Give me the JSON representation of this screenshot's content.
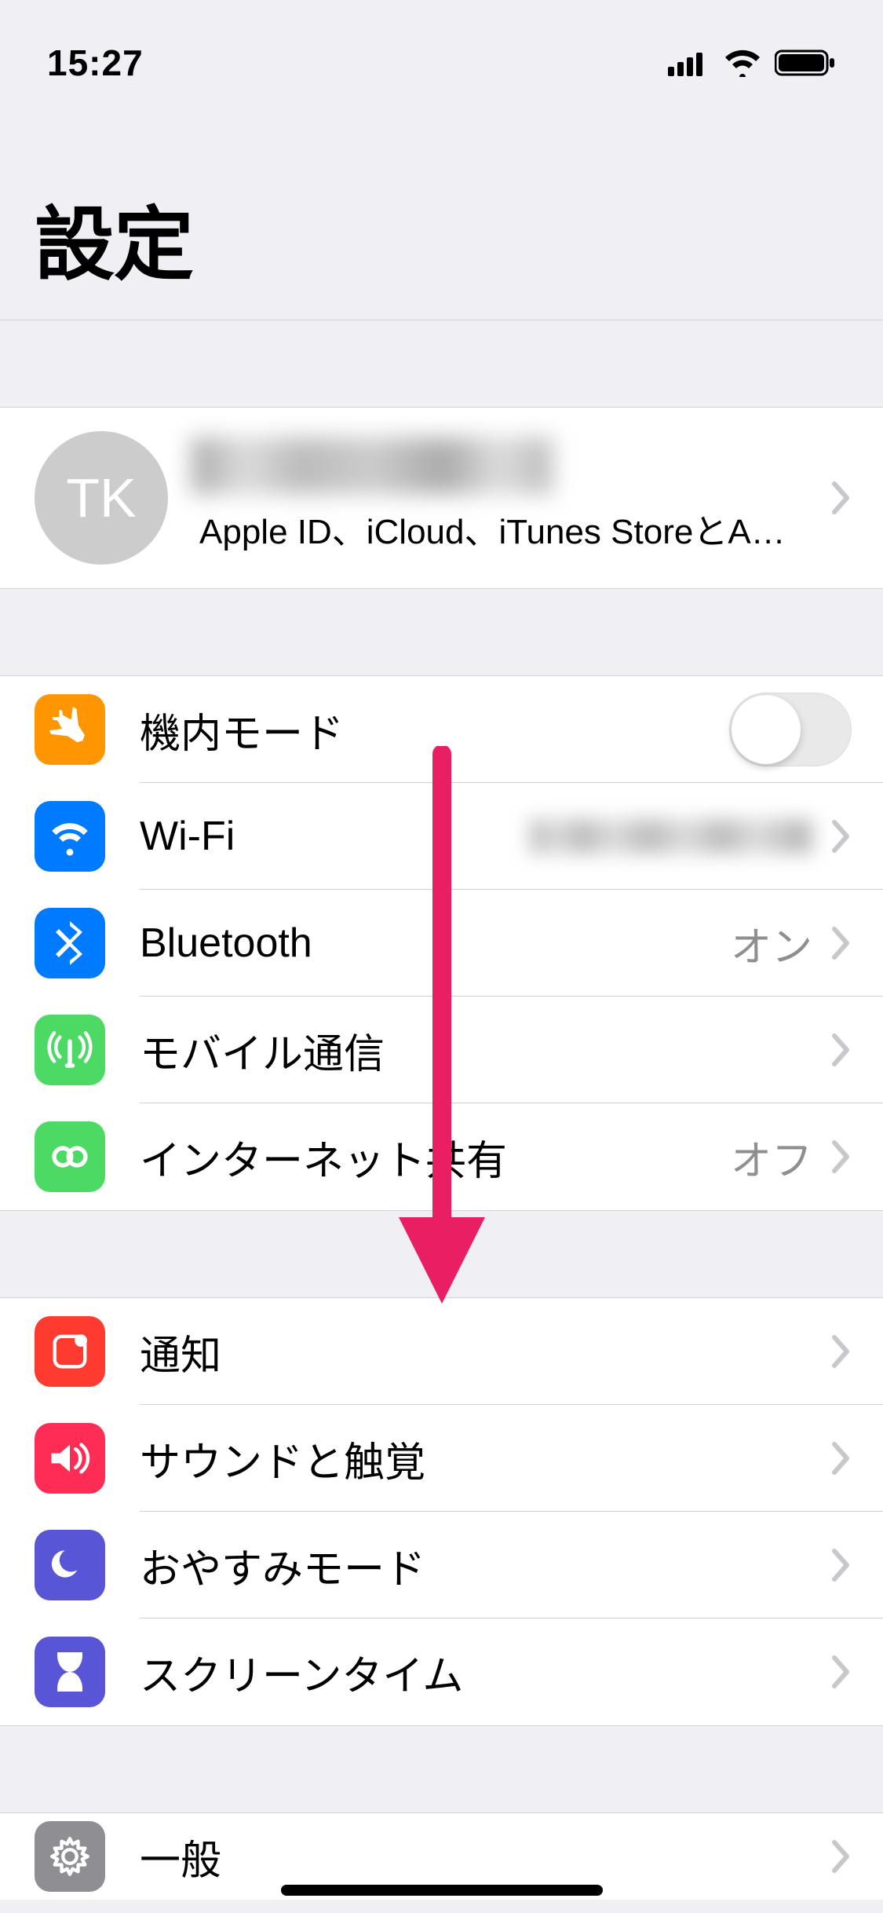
{
  "status": {
    "time": "15:27"
  },
  "page": {
    "title": "設定"
  },
  "profile": {
    "initials": "TK",
    "subtitle": "Apple ID、iCloud、iTunes StoreとApp S..."
  },
  "group1": {
    "airplane": {
      "label": "機内モード",
      "icon_bg": "#ff9500"
    },
    "wifi": {
      "label": "Wi-Fi",
      "icon_bg": "#007aff"
    },
    "bluetooth": {
      "label": "Bluetooth",
      "value": "オン",
      "icon_bg": "#007aff"
    },
    "cellular": {
      "label": "モバイル通信",
      "icon_bg": "#4cd964"
    },
    "hotspot": {
      "label": "インターネット共有",
      "value": "オフ",
      "icon_bg": "#4cd964"
    }
  },
  "group2": {
    "notifications": {
      "label": "通知",
      "icon_bg": "#ff3b30"
    },
    "sounds": {
      "label": "サウンドと触覚",
      "icon_bg": "#ff2d55"
    },
    "dnd": {
      "label": "おやすみモード",
      "icon_bg": "#5856d6"
    },
    "screentime": {
      "label": "スクリーンタイム",
      "icon_bg": "#5856d6"
    }
  },
  "group3": {
    "general": {
      "label": "一般",
      "icon_bg": "#8e8e93"
    }
  }
}
